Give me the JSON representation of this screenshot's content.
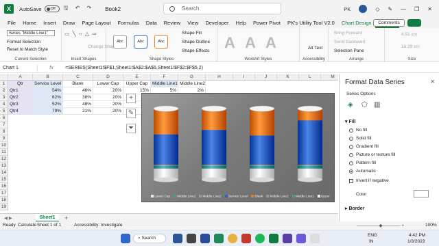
{
  "titlebar": {
    "autosave_label": "AutoSave",
    "autosave_state": "Off",
    "book_name": "Book2",
    "search_placeholder": "Search",
    "user_initials": "PK"
  },
  "menu": {
    "items": [
      "File",
      "Home",
      "Insert",
      "Draw",
      "Page Layout",
      "Formulas",
      "Data",
      "Review",
      "View",
      "Developer",
      "Help",
      "Power Pivot",
      "PK's Utility Tool V2.0",
      "Chart Design",
      "Format"
    ],
    "active": "Format",
    "comments_label": "Comments"
  },
  "ribbon": {
    "selection_box": "Series \"Middle Line1\"",
    "format_selection": "Format Selection",
    "reset_to_match": "Reset to Match Style",
    "current_selection_label": "Current Selection",
    "insert_shapes_label": "Insert Shapes",
    "change_shape": "Change Shape",
    "shape_styles_label": "Shape Styles",
    "shape_fill": "Shape Fill",
    "shape_outline": "Shape Outline",
    "shape_effects": "Shape Effects",
    "style_tile_text": "Abc",
    "wordart_label": "WordArt Styles",
    "alt_text": "Alt Text",
    "accessibility_label": "Accessibility",
    "bring_forward": "Bring Forward",
    "send_backward": "Send Backward",
    "selection_pane": "Selection Pane",
    "arrange_label": "Arrange",
    "size_label": "Size",
    "height_value": "4.51 cm",
    "width_value": "16.29 cm"
  },
  "formula_bar": {
    "name_box": "Chart 1",
    "fx": "fx",
    "formula": "=SERIES(Sheet1!$F$1,Sheet1!$A$2:$A$5,Sheet1!$F$2:$F$5,2)"
  },
  "grid": {
    "columns": [
      "A",
      "B",
      "C",
      "D",
      "E",
      "F",
      "G",
      "H",
      "I",
      "J",
      "K",
      "L",
      "M"
    ],
    "rows": [
      "1",
      "2",
      "3",
      "4",
      "5",
      "6",
      "7",
      "8",
      "9",
      "10",
      "11",
      "12",
      "13",
      "14",
      "15",
      "16",
      "17",
      "18",
      "19"
    ],
    "headers": [
      "Qtr",
      "Service Level",
      "Blank",
      "Lower Cap",
      "Upper Cap",
      "Middle Line1",
      "Middle Line2"
    ],
    "data": [
      [
        "Qtr1",
        "54%",
        "46%",
        "20%",
        "15%",
        "5%",
        "2%"
      ],
      [
        "Qtr2",
        "62%",
        "38%",
        "20%",
        "",
        "",
        ""
      ],
      [
        "Qtr3",
        "52%",
        "48%",
        "20%",
        "",
        "",
        ""
      ],
      [
        "Qtr4",
        "79%",
        "21%",
        "20%",
        "",
        "",
        ""
      ]
    ]
  },
  "chart_data": {
    "type": "bar",
    "stacked": true,
    "categories": [
      "Qtr1",
      "Qtr2",
      "Qtr3",
      "Qtr4"
    ],
    "series": [
      {
        "name": "Lower Cap",
        "values": [
          20,
          20,
          20,
          20
        ]
      },
      {
        "name": "Middle Line1",
        "values": [
          5,
          5,
          5,
          5
        ]
      },
      {
        "name": "Middle Line2",
        "values": [
          2,
          2,
          2,
          2
        ]
      },
      {
        "name": "Service Level",
        "values": [
          54,
          62,
          52,
          79
        ]
      },
      {
        "name": "Blank",
        "values": [
          46,
          38,
          48,
          21
        ]
      }
    ],
    "legend_entries": [
      "Lower Cap",
      "Middle Line1",
      "Middle Line2",
      "Service Level",
      "Blank",
      "Middle Line2",
      "Middle Line1",
      "Upper Cap"
    ],
    "legend_position": "bottom",
    "colors": {
      "Lower Cap": "#e8e8e8",
      "Middle Line1": "#3aa0a0",
      "Middle Line2": "#9a9a9a",
      "Service Level": "#2f66c9",
      "Blank": "#ef7d1e",
      "Upper Cap": "#f0f0f0"
    }
  },
  "sheet": {
    "tab": "Sheet1"
  },
  "statusbar": {
    "ready": "Ready",
    "calculate": "Calculate",
    "sheet_of": "Sheet 1 of 1",
    "accessibility": "Accessibility: Investigate",
    "zoom": "100%"
  },
  "pane": {
    "title": "Format Data Series",
    "options": "Series Options",
    "fill_header": "Fill",
    "fill_options": [
      "No fill",
      "Solid fill",
      "Gradient fill",
      "Picture or texture fill",
      "Pattern fill",
      "Automatic"
    ],
    "selected_fill": "Automatic",
    "invert_label": "Invert if negative",
    "color_label": "Color",
    "border_header": "Border"
  },
  "taskbar": {
    "search": "Search",
    "lang1": "ENG",
    "lang2": "IN",
    "time": "4:42 PM",
    "date": "1/3/2023"
  }
}
